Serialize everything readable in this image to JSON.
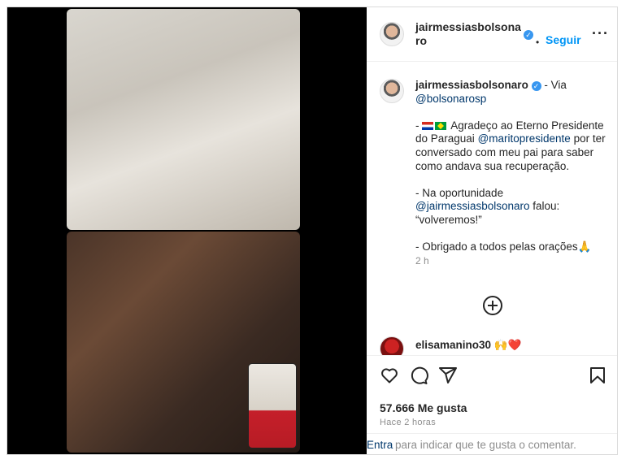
{
  "header": {
    "username": "jairmessiasbolsonaro",
    "verified_mark": "✓",
    "dot": "•",
    "follow_label": "Seguir",
    "more_icon": "more-horizontal-icon"
  },
  "caption": {
    "username": "jairmessiasbolsonaro",
    "via_text": " - Via",
    "via_handle": "@bolsonarosp",
    "line1_prefix": "- ",
    "line1_text": " Agradeço ao Eterno Presidente do Paraguai ",
    "line1_handle": "@maritopresidente",
    "line1_suffix": " por ter conversado com meu pai para saber como andava sua recuperação.",
    "line2_prefix": "- Na oportunidade ",
    "line2_handle": "@jairmessiasbolsonaro",
    "line2_suffix": " falou: “volveremos!”",
    "line3": "- Obrigado a todos pelas orações🙏",
    "time": "2 h"
  },
  "comment": {
    "username": "elisamanino30",
    "emoji": " 🙌❤️"
  },
  "actions": {
    "likes": "57.666 Me gusta",
    "posted": "Hace 2 horas"
  },
  "comment_bar": {
    "enter_label": "Entra",
    "hint": " para indicar que te gusta o comentar."
  }
}
